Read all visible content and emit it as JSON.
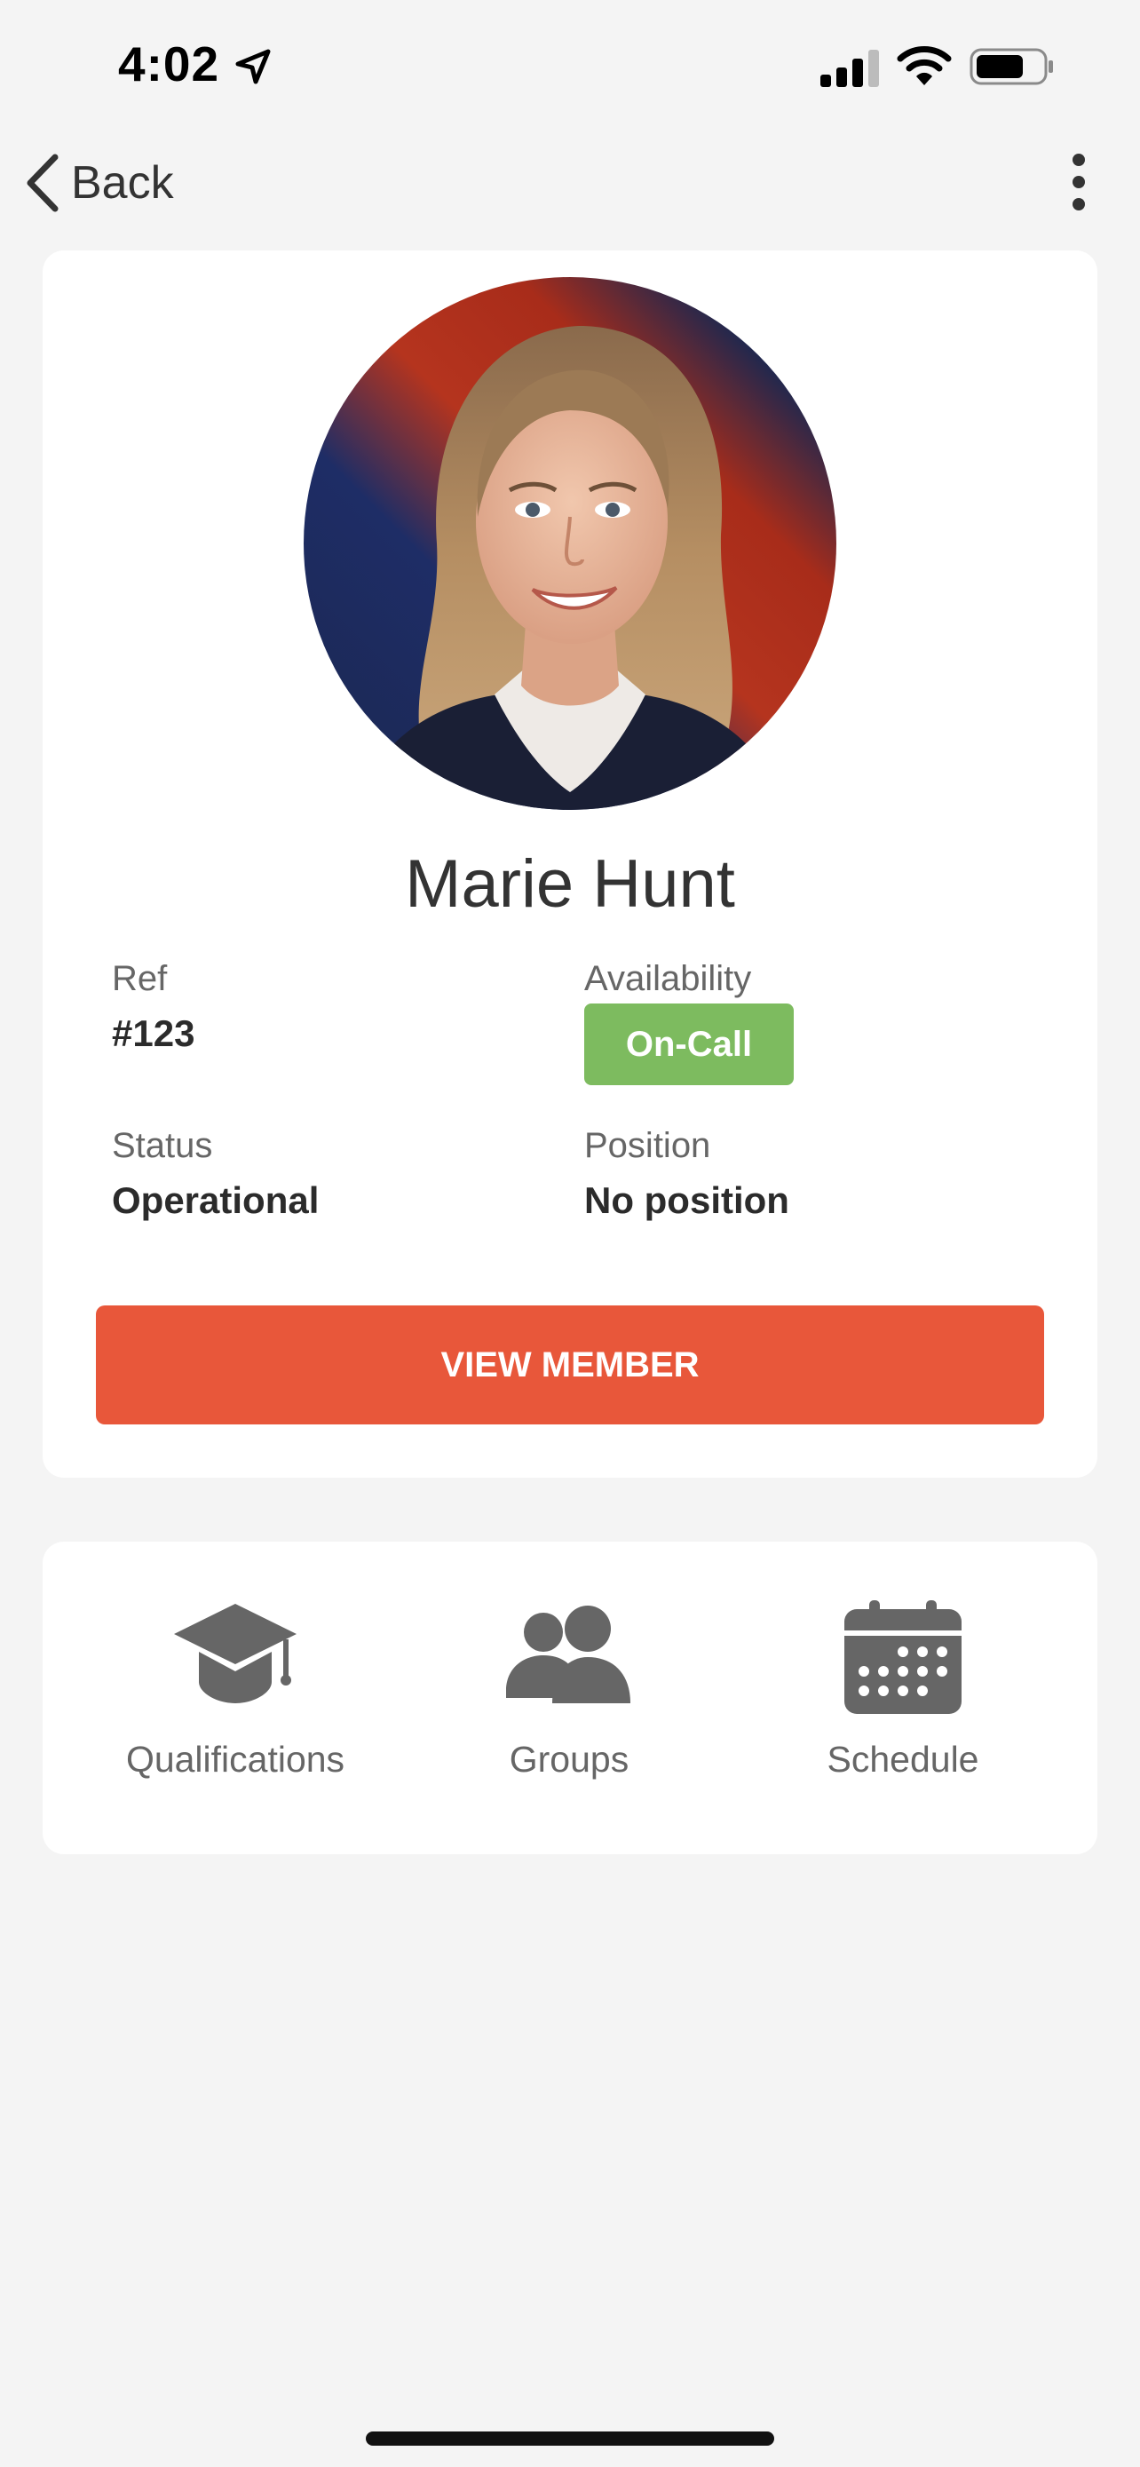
{
  "status_bar": {
    "time": "4:02"
  },
  "nav": {
    "back_label": "Back"
  },
  "profile": {
    "name": "Marie Hunt",
    "ref_label": "Ref",
    "ref_value": "#123",
    "availability_label": "Availability",
    "availability_value": "On-Call",
    "status_label": "Status",
    "status_value": "Operational",
    "position_label": "Position",
    "position_value": "No position",
    "view_member_label": "VIEW MEMBER"
  },
  "shortcuts": [
    {
      "label": "Qualifications",
      "icon": "graduation-cap-icon"
    },
    {
      "label": "Groups",
      "icon": "users-icon"
    },
    {
      "label": "Schedule",
      "icon": "calendar-icon"
    }
  ],
  "colors": {
    "accent_button": "#e8573a",
    "availability_badge": "#7dbb5f",
    "background": "#f4f4f4",
    "icon_gray": "#666666"
  }
}
